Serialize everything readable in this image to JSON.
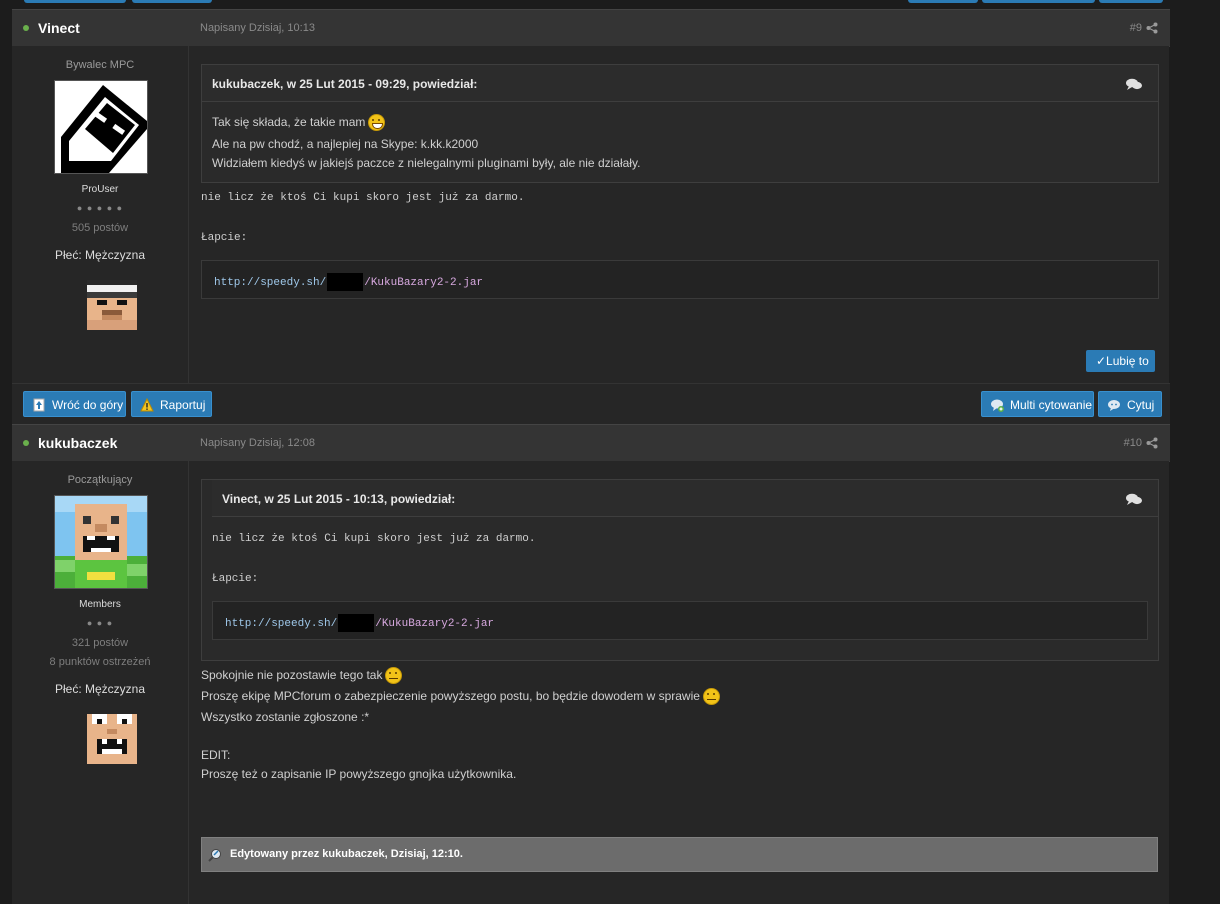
{
  "posts": [
    {
      "author": "Vinect",
      "date": "Napisany Dzisiaj, 10:13",
      "number": "#9",
      "member_title": "Bywalec MPC",
      "group": "ProUser",
      "pips": "● ● ● ● ●",
      "post_count": "505 postów",
      "sex": "Płeć: Mężczyzna",
      "quote": {
        "header": "kukubaczek, w 25 Lut 2015 - 09:29, powiedział:",
        "line1": "Tak się składa, że takie mam",
        "line2": "Ale na pw chodź, a najlepiej na Skype: k.kk.k2000",
        "line3": "Widziałem kiedyś w jakiejś paczce z nielegalnymi pluginami były, ale nie działały."
      },
      "body_line1": "nie licz że ktoś Ci kupi skoro jest już za darmo.",
      "body_line2": "Łapcie:",
      "code_prefix": "http://speedy.sh/",
      "code_suffix": "/KukuBazary2-2.jar",
      "like_label": "✓Lubię to"
    },
    {
      "author": "kukubaczek",
      "date": "Napisany Dzisiaj, 12:08",
      "number": "#10",
      "member_title": "Początkujący",
      "group": "Members",
      "pips": "● ● ●",
      "post_count": "321 postów",
      "warn": "8 punktów ostrzeżeń",
      "sex": "Płeć: Mężczyzna",
      "quote": {
        "header": "Vinect, w 25 Lut 2015 - 10:13, powiedział:",
        "line1": "nie licz że ktoś Ci kupi skoro jest już za darmo.",
        "line2": "Łapcie:",
        "code_prefix": "http://speedy.sh/",
        "code_suffix": "/KukuBazary2-2.jar"
      },
      "body": [
        "Spokojnie nie pozostawie tego tak",
        "Proszę ekipę MPCforum o zabezpieczenie powyższego postu, bo będzie dowodem w sprawie",
        "Wszystko zostanie zgłoszone :*",
        "EDIT:",
        "Proszę też o zapisanie IP powyższego gnojka użytkownika."
      ],
      "edited": "Edytowany przez kukubaczek, Dzisiaj, 12:10."
    }
  ],
  "buttons": {
    "top": "Wróć do góry",
    "report": "Raportuj",
    "multi": "Multi cytowanie",
    "quote": "Cytuj"
  },
  "colors": {
    "accent": "#2b7bb5",
    "online": "#6ab04c"
  }
}
